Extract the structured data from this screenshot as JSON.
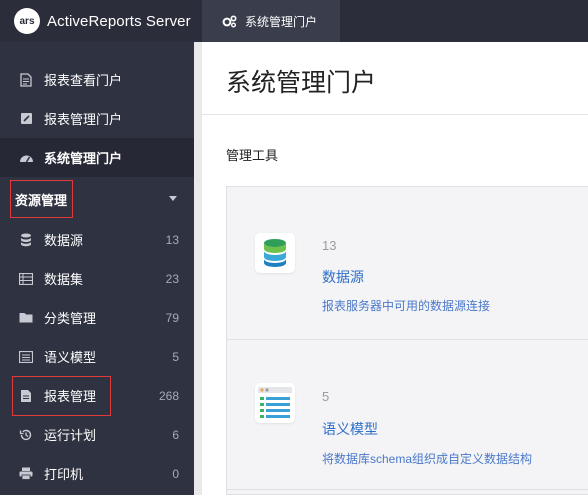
{
  "app": {
    "logo_badge": "ars",
    "name": "ActiveReports Server"
  },
  "top_tab": {
    "label": "系统管理门户"
  },
  "sidebar": {
    "items": [
      {
        "label": "报表查看门户",
        "icon": "document-icon"
      },
      {
        "label": "报表管理门户",
        "icon": "edit-square-icon"
      },
      {
        "label": "系统管理门户",
        "icon": "dashboard-gauge-icon"
      }
    ],
    "section": {
      "label": "资源管理",
      "icon": "chevron-down-icon"
    },
    "resources": [
      {
        "label": "数据源",
        "count": "13",
        "icon": "database-icon"
      },
      {
        "label": "数据集",
        "count": "23",
        "icon": "table-list-icon"
      },
      {
        "label": "分类管理",
        "count": "79",
        "icon": "folder-icon"
      },
      {
        "label": "语义模型",
        "count": "5",
        "icon": "list-window-icon"
      },
      {
        "label": "报表管理",
        "count": "268",
        "icon": "file-text-icon"
      },
      {
        "label": "运行计划",
        "count": "6",
        "icon": "history-icon"
      },
      {
        "label": "打印机",
        "count": "0",
        "icon": "printer-icon"
      }
    ]
  },
  "main": {
    "title": "系统管理门户",
    "section_label": "管理工具",
    "tools": [
      {
        "count": "13",
        "name": "数据源",
        "desc": "报表服务器中可用的数据源连接",
        "icon": "database-stack-icon"
      },
      {
        "count": "5",
        "name": "语义模型",
        "desc": "将数据库schema组织成自定义数据结构",
        "icon": "semantic-model-icon"
      }
    ]
  },
  "colors": {
    "sidebar_bg": "#2f3240",
    "topbar_bg": "#2b2e3a",
    "link": "#2f6ec8",
    "highlight_border": "#e23a3a"
  }
}
